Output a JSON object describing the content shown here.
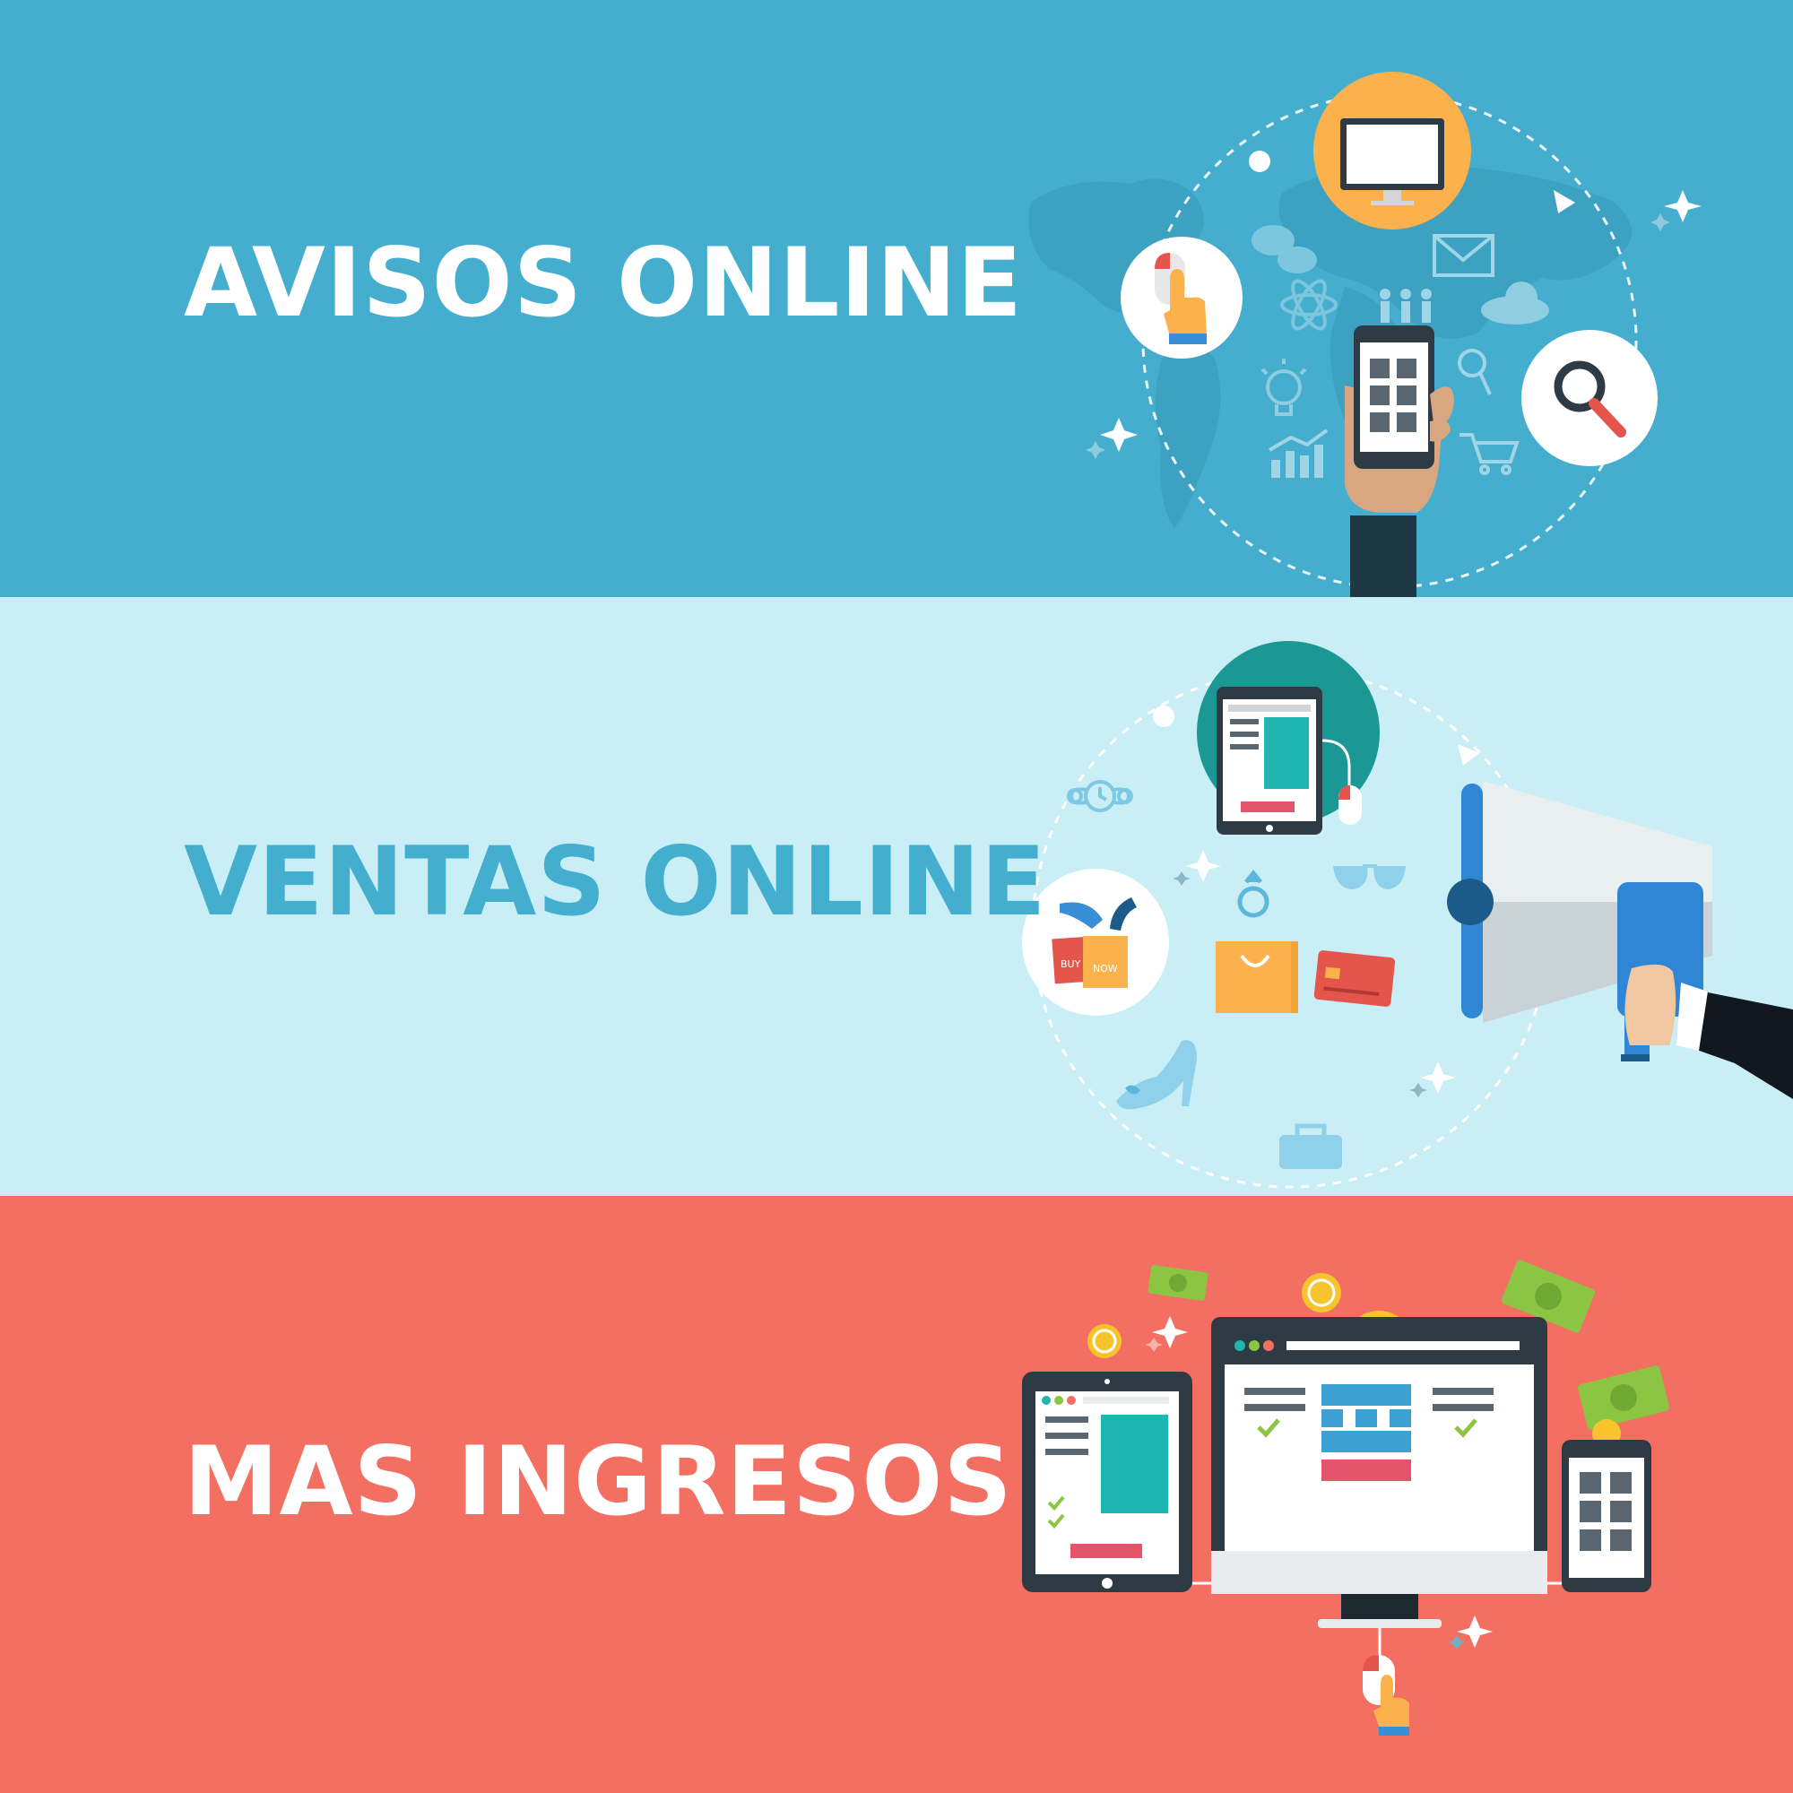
{
  "colors": {
    "band_1": "#45aecf",
    "band_2": "#c9eef5",
    "band_3": "#f36f62",
    "headline_light": "#ffffff",
    "headline_dark": "#44aecf",
    "accent_orange": "#fbb24d",
    "accent_teal": "#1fb6b0",
    "accent_red": "#e4554b",
    "money_green": "#8cc542",
    "coin_yellow": "#f8c42c",
    "dark_navy": "#24333c"
  },
  "sections": [
    {
      "headline": "AVISOS ONLINE",
      "icons": [
        "world-map-icon",
        "monitor-icon",
        "pointer-hand-icon",
        "magnifier-icon",
        "smartphone-icon",
        "email-icon",
        "chat-icon",
        "atom-icon",
        "people-icon",
        "cloud-icon",
        "lightbulb-icon",
        "chart-icon",
        "cart-icon",
        "sparkle-icon"
      ]
    },
    {
      "headline": "VENTAS ONLINE",
      "icons": [
        "tablet-icon",
        "mouse-icon",
        "shopping-bags-icon",
        "megaphone-icon",
        "shopping-bag-icon",
        "credit-card-icon",
        "ring-icon",
        "glasses-icon",
        "watch-icon",
        "heel-shoe-icon",
        "briefcase-icon",
        "sparkle-icon"
      ],
      "bag_labels": [
        "BUY",
        "NOW"
      ]
    },
    {
      "headline": "MAS INGRESOS",
      "icons": [
        "tablet-icon",
        "desktop-monitor-icon",
        "smartphone-icon",
        "mouse-icon",
        "banknote-icon",
        "coin-icon",
        "sparkle-icon"
      ]
    }
  ]
}
